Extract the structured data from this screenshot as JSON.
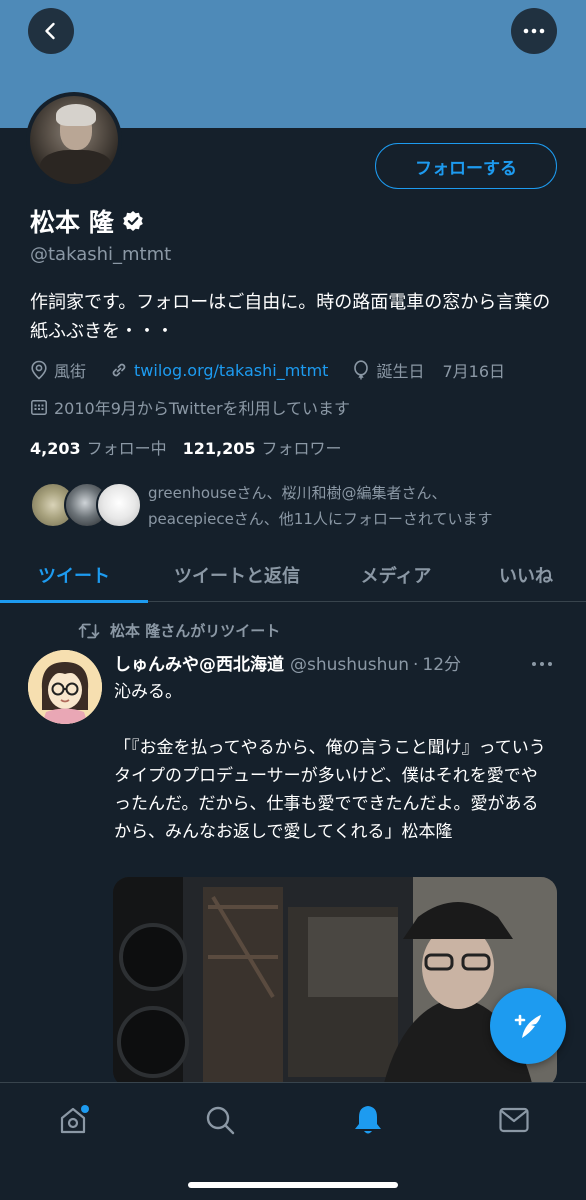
{
  "profile": {
    "follow_button": "フォローする",
    "name": "松本 隆",
    "handle": "@takashi_mtmt",
    "bio": "作詞家です。フォローはご自由に。時の路面電車の窓から言葉の紙ふぶきを・・・",
    "location": "風街",
    "website": "twilog.org/takashi_mtmt",
    "birthday_label": "誕生日",
    "birthday": "7月16日",
    "joined": "2010年9月からTwitterを利用しています",
    "following_count": "4,203",
    "following_label": "フォロー中",
    "followers_count": "121,205",
    "followers_label": "フォロワー",
    "known_followers_line1": "greenhouseさん、桜川和樹@編集者さん、",
    "known_followers_line2": "peacepieceさん、他11人にフォローされています"
  },
  "tabs": [
    {
      "label": "ツイート",
      "active": true
    },
    {
      "label": "ツイートと返信",
      "active": false
    },
    {
      "label": "メディア",
      "active": false
    },
    {
      "label": "いいね",
      "active": false
    }
  ],
  "tweet": {
    "retweeted_by": "松本 隆さんがリツイート",
    "author_name": "しゅんみや@西北海道",
    "author_handle": "@shushushun",
    "time": "12分",
    "text": "沁みる。\n\n「『お金を払ってやるから、俺の言うこと聞け』っていうタイプのプロデューサーが多いけど、僕はそれを愛でやったんだ。だから、仕事も愛でできたんだよ。愛があるから、みんなお返しで愛してくれる」松本隆"
  },
  "colors": {
    "background": "#15202b",
    "accent": "#1d9bf0",
    "banner": "#4e8ab8",
    "muted_text": "#8b98a5"
  },
  "icons": [
    "back-arrow-icon",
    "more-icon",
    "verified-badge-icon",
    "location-icon",
    "link-icon",
    "balloon-icon",
    "calendar-icon",
    "retweet-icon",
    "compose-tweet-icon",
    "home-icon",
    "search-icon",
    "notifications-bell-icon",
    "messages-mail-icon"
  ]
}
